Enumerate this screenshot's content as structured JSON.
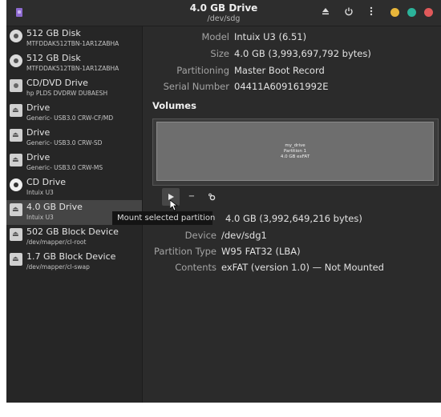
{
  "window": {
    "title": "4.0 GB Drive",
    "subtitle": "/dev/sdg"
  },
  "headerbar": {
    "eject_icon": "eject-icon",
    "power_icon": "power-icon",
    "menu_icon": "kebab-menu-icon"
  },
  "traffic_lights": [
    "#e8b63a",
    "#2bb39a",
    "#e0595a"
  ],
  "sidebar": {
    "items": [
      {
        "name": "512 GB Disk",
        "sub": "MTFDDAK512TBN-1AR1ZABHA",
        "icon": "hard-disk-icon"
      },
      {
        "name": "512 GB Disk",
        "sub": "MTFDDAK512TBN-1AR1ZABHA",
        "icon": "hard-disk-icon"
      },
      {
        "name": "CD/DVD Drive",
        "sub": "hp PLDS DVDRW  DU8AESH",
        "icon": "optical-drive-icon"
      },
      {
        "name": "Drive",
        "sub": "Generic- USB3.0 CRW-CF/MD",
        "icon": "removable-drive-icon"
      },
      {
        "name": "Drive",
        "sub": "Generic- USB3.0 CRW-SD",
        "icon": "removable-drive-icon"
      },
      {
        "name": "Drive",
        "sub": "Generic- USB3.0 CRW-MS",
        "icon": "removable-drive-icon"
      },
      {
        "name": "CD Drive",
        "sub": "Intuix U3",
        "icon": "cd-icon"
      },
      {
        "name": "4.0 GB Drive",
        "sub": "Intuix U3",
        "icon": "removable-drive-icon"
      },
      {
        "name": "502 GB Block Device",
        "sub": "/dev/mapper/cl-root",
        "icon": "block-device-icon"
      },
      {
        "name": "1.7 GB Block Device",
        "sub": "/dev/mapper/cl-swap",
        "icon": "block-device-icon"
      }
    ],
    "selected_index": 7
  },
  "drive_info": {
    "model_label": "Model",
    "model": "Intuix U3 (6.51)",
    "size_label": "Size",
    "size": "4.0 GB (3,993,697,792 bytes)",
    "partitioning_label": "Partitioning",
    "partitioning": "Master Boot Record",
    "serial_label": "Serial Number",
    "serial": "04411A609161992E"
  },
  "volumes": {
    "heading": "Volumes",
    "partition": {
      "name": "my_drive",
      "label": "Partition 1",
      "detail": "4.0 GB exFAT"
    }
  },
  "toolbar": {
    "tooltip": "Mount selected partition",
    "minus": "−"
  },
  "partition_info": {
    "size_value": "4.0 GB (3,992,649,216 bytes)",
    "device_label": "Device",
    "device": "/dev/sdg1",
    "type_label": "Partition Type",
    "type": "W95 FAT32 (LBA)",
    "contents_label": "Contents",
    "contents": "exFAT (version 1.0) — Not Mounted"
  }
}
